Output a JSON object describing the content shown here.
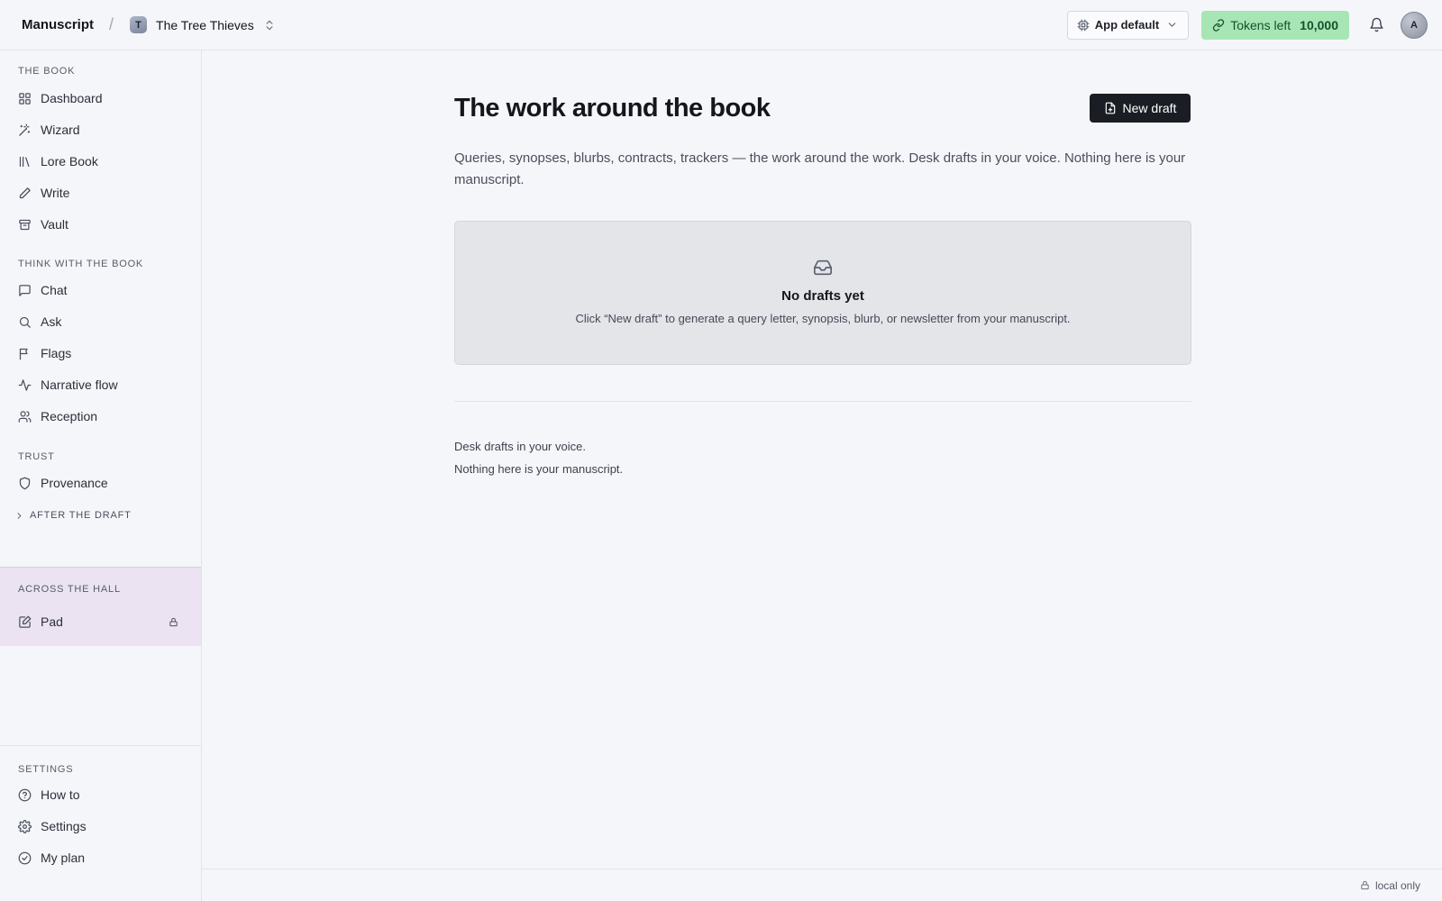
{
  "header": {
    "brand": "Manuscript",
    "separator": "/",
    "project_initial": "T",
    "project_name": "The Tree Thieves",
    "model_select": "App default",
    "tokens_label": "Tokens left",
    "tokens_value": "10,000",
    "user_initial": "A"
  },
  "sidebar": {
    "sections": [
      {
        "label": "THE BOOK",
        "items": [
          "Dashboard",
          "Wizard",
          "Lore Book",
          "Write",
          "Vault"
        ]
      },
      {
        "label": "THINK WITH THE BOOK",
        "items": [
          "Chat",
          "Ask",
          "Flags",
          "Narrative flow",
          "Reception"
        ]
      },
      {
        "label": "TRUST",
        "items": [
          "Provenance"
        ]
      }
    ],
    "collapsed_section": "AFTER THE DRAFT",
    "hall_label": "ACROSS THE HALL",
    "hall_item": "Pad",
    "settings_label": "SETTINGS",
    "settings_items": [
      "How to",
      "Settings",
      "My plan"
    ]
  },
  "main": {
    "title": "The work around the book",
    "new_draft_label": "New draft",
    "intro": "Queries, synopses, blurbs, contracts, trackers — the work around the work. Desk drafts in your voice. Nothing here is your manuscript.",
    "empty_title": "No drafts yet",
    "empty_subtitle": "Click “New draft” to generate a query letter, synopsis, blurb, or newsletter from your manuscript.",
    "footer_line1": "Desk drafts in your voice.",
    "footer_line2": "Nothing here is your manuscript."
  },
  "statusbar": {
    "text": "local only"
  },
  "colors": {
    "accent_dark": "#1a1d23",
    "tokens_bg": "#a7e6b4",
    "hall_bg": "#ebe3f2"
  }
}
